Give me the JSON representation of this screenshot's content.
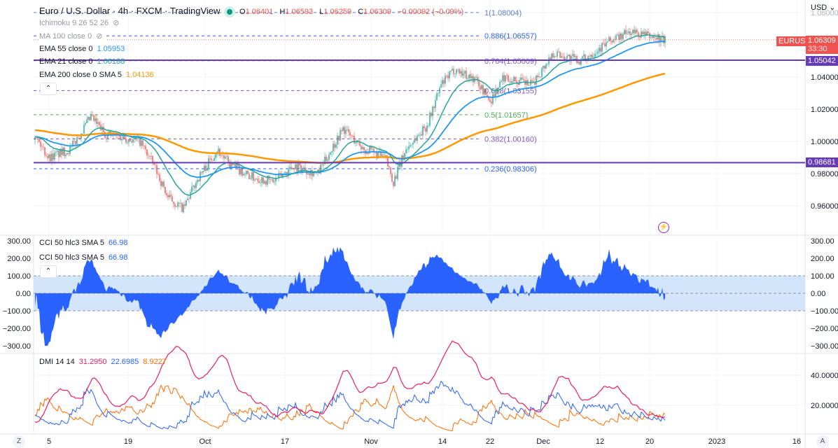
{
  "header": {
    "title": "Euro / U.S. Dollar · 4h · FXCM · TradingView",
    "ohlc": {
      "o_label": "O",
      "o": "1.06401",
      "h_label": "H",
      "h": "1.06593",
      "l_label": "L",
      "l": "1.06259",
      "c_label": "C",
      "c": "1.06309",
      "change": "−0.00092 (−0.09%)"
    }
  },
  "indicators": {
    "ichimoku": "Ichimoku 9 26 52 26",
    "ma100": "MA 100 close 0",
    "ema55": {
      "label": "EMA 55 close 0",
      "value": "1.05953",
      "color": "#2196f3"
    },
    "ema21": {
      "label": "EMA 21 close 0",
      "value": "1.06188",
      "color": "#26a69a"
    },
    "ema200": {
      "label": "EMA 200 close 0 SMA 5",
      "value": "1.04136",
      "color": "#ff9800"
    },
    "cci": [
      {
        "label": "CCI 50 hlc3 SMA 5",
        "value": "66.98"
      },
      {
        "label": "CCI 50 hlc3 SMA 5",
        "value": "66.98"
      }
    ],
    "dmi": {
      "label": "DMI 14 14",
      "adx": "31.2950",
      "plus": "22.6985",
      "minus": "8.9227"
    }
  },
  "price_axis": {
    "currency": "USD",
    "ticks": [
      "1.08000",
      "1.04000",
      "1.02000",
      "1.00000",
      "0.98000",
      "0.96000"
    ],
    "tick_values": [
      1.08,
      1.04,
      1.02,
      1.0,
      0.98,
      0.96
    ],
    "symbol_tag": "EURUSD",
    "last_price": "1.06309",
    "countdown": "33:30",
    "hlines": [
      {
        "label": "1.05042",
        "value": 1.05042
      },
      {
        "label": "0.98681",
        "value": 0.98681
      }
    ]
  },
  "fib_levels": [
    {
      "label": "1(1.08004)",
      "value": 1.08004,
      "color": "#5c7ccf"
    },
    {
      "label": "0.886(1.06557)",
      "value": 1.06557,
      "color": "#2962ff"
    },
    {
      "label": "0.764(1.05009)",
      "value": 1.05009,
      "color": "#7e57c2"
    },
    {
      "label": "0.618(1.03155)",
      "value": 1.03155,
      "color": "#7e57c2"
    },
    {
      "label": "0.5(1.01657)",
      "value": 1.01657,
      "color": "#4caf50"
    },
    {
      "label": "0.382(1.00160)",
      "value": 1.0016,
      "color": "#7e57c2"
    },
    {
      "label": "0.236(0.98306)",
      "value": 0.98306,
      "color": "#2962ff"
    }
  ],
  "cci_axis": {
    "ticks": [
      "300.00",
      "200.00",
      "100.00",
      "0.00",
      "−100.00",
      "−200.00",
      "−300.00"
    ],
    "values": [
      300,
      200,
      100,
      0,
      -100,
      -200,
      -300
    ]
  },
  "dmi_axis": {
    "ticks": [
      "40.0000",
      "20.0000"
    ],
    "values": [
      40,
      20
    ]
  },
  "time_axis": {
    "labels": [
      "5",
      "19",
      "Oct",
      "17",
      "Nov",
      "14",
      "22",
      "Dec",
      "12",
      "20",
      "2023",
      "16"
    ]
  },
  "bottom": {
    "left_button": "Z",
    "right_button": "A"
  },
  "price_path": [
    [
      0,
      1.003
    ],
    [
      10,
      0.99
    ],
    [
      25,
      0.995
    ],
    [
      40,
      1.015
    ],
    [
      50,
      1.005
    ],
    [
      75,
      1.0
    ],
    [
      85,
      0.985
    ],
    [
      95,
      0.965
    ],
    [
      106,
      0.958
    ],
    [
      115,
      0.975
    ],
    [
      130,
      0.995
    ],
    [
      140,
      0.985
    ],
    [
      155,
      0.978
    ],
    [
      170,
      0.975
    ],
    [
      185,
      0.985
    ],
    [
      202,
      0.98
    ],
    [
      220,
      1.008
    ],
    [
      235,
      0.995
    ],
    [
      250,
      0.99
    ],
    [
      256,
      0.975
    ],
    [
      265,
      0.995
    ],
    [
      280,
      1.01
    ],
    [
      290,
      1.035
    ],
    [
      300,
      1.045
    ],
    [
      315,
      1.038
    ],
    [
      325,
      1.025
    ],
    [
      335,
      1.04
    ],
    [
      355,
      1.035
    ],
    [
      370,
      1.055
    ],
    [
      390,
      1.05
    ],
    [
      410,
      1.062
    ],
    [
      425,
      1.068
    ],
    [
      450,
      1.063
    ]
  ],
  "colors": {
    "up": "#26a69a",
    "down": "#ef5350",
    "hline": "#673ab7",
    "cci": "#2962ff",
    "adx": "#e91e63",
    "plus_di": "#2962ff",
    "minus_di": "#ff6d00",
    "tag_red": "#ef5350"
  }
}
